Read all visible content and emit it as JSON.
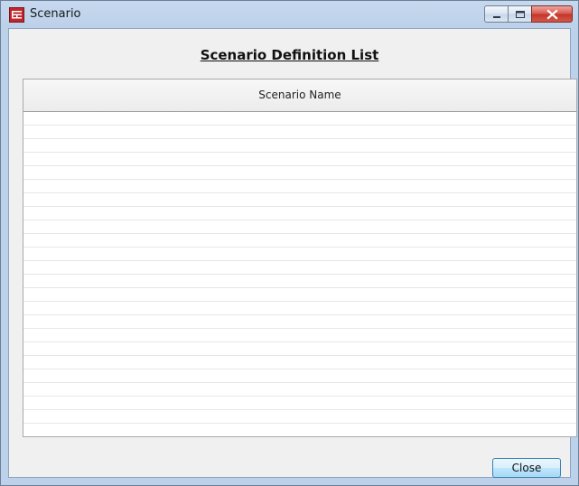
{
  "window": {
    "title": "Scenario",
    "icon": "scenario-app-icon",
    "controls": {
      "minimize_icon": "minimize-icon",
      "maximize_icon": "maximize-icon",
      "close_icon": "close-icon"
    }
  },
  "main": {
    "heading": "Scenario Definition List",
    "table": {
      "columns": [
        "Scenario Name"
      ],
      "rows": []
    },
    "close_label": "Close"
  },
  "colors": {
    "titlebar": "#bcd1ea",
    "client_background": "#f0f0f0",
    "close_caption_button": "#c1352a",
    "button_accent": "#bee6fd"
  }
}
